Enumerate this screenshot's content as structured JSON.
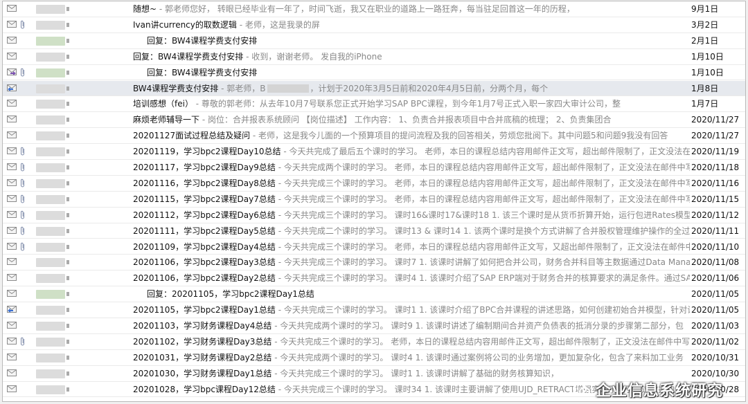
{
  "colors": {
    "subject": "#111111",
    "preview": "#888888",
    "selected_bg": "#e6e9ee",
    "row_border": "#eaeaea"
  },
  "watermark": {
    "text": "企业信息系统研究"
  },
  "emails": [
    {
      "id": "r0",
      "icon": "envelope-icon",
      "clip": false,
      "sender_color": "gray",
      "indent": false,
      "subject": "随想~",
      "preview": " - 郭老师您好， 转眼已经毕业有一年了，时间飞逝，我又在职业的道路上一路狂奔，每当驻足回首这一年的历程，",
      "date": "9月1日"
    },
    {
      "id": "r1",
      "icon": "envelope-icon",
      "clip": true,
      "sender_color": "gray",
      "indent": false,
      "subject": "Ivan讲currency的取数逻辑",
      "preview": " - 老师，这是我录的屏",
      "date": "3月2日"
    },
    {
      "id": "r2",
      "icon": "envelope-icon",
      "clip": false,
      "sender_color": "green",
      "indent": true,
      "subject": "回复：BW4课程学费支付安排",
      "preview": "",
      "date": "2月1日"
    },
    {
      "id": "r3",
      "icon": "envelope-icon",
      "clip": false,
      "sender_color": "gray",
      "indent": false,
      "subject": "回复：BW4课程学费支付安排",
      "preview": " - 收到，谢谢老师。 发自我的iPhone",
      "date": "1月10日"
    },
    {
      "id": "r4",
      "icon": "forwarded-envelope-icon",
      "clip": true,
      "sender_color": "green",
      "indent": true,
      "subject": "回复：BW4课程学费支付安排",
      "preview": "",
      "date": "1月10日"
    },
    {
      "id": "r5",
      "icon": "replied-envelope-icon",
      "clip": false,
      "sender_color": "gray",
      "indent": false,
      "subject": "BW4课程学费支付安排",
      "preview": " - 郭老师，B",
      "preview2": "，计划于2020年3月5日前和2020年4月5日前，分两个月，每个",
      "date": "1月8日",
      "selected": true
    },
    {
      "id": "r6",
      "icon": "envelope-icon",
      "clip": false,
      "sender_color": "gray",
      "indent": false,
      "subject": "培训感想（fei）",
      "preview": " - 尊敬的郭老师：从去年10月7号联系您正式开始学习SAP BPC课程，到今年1月7号正式入职一家四大审计公司，整",
      "date": "1月7日"
    },
    {
      "id": "r7",
      "icon": "envelope-icon",
      "clip": false,
      "sender_color": "gray",
      "indent": false,
      "subject": "麻烦老师辅导一下",
      "preview": " - 岗位：合并报表系统顾问 【岗位描述】 工作内容： 1、负责合并报表项目中合并底稿的梳理； 2、负责集团合",
      "date": "2020/11/27"
    },
    {
      "id": "r8",
      "icon": "envelope-icon",
      "clip": false,
      "sender_color": "gray",
      "indent": false,
      "subject": "20201127面试过程总结及疑问",
      "preview": " - 老师，这是我今儿面的一个预算项目的提问流程及我的回答相关，劳烦您批阅下。其中问题5和问题9我没有回答",
      "date": "2020/11/27"
    },
    {
      "id": "r9",
      "icon": "envelope-icon",
      "clip": true,
      "sender_color": "gray",
      "indent": false,
      "subject": "20201119，学习bpc2课程Day10总结",
      "preview": " - 今天共完成了最后五个课时的学习。 老师，本日的课程总结内容用邮件正文写，超出邮件限制了，正文没法在邮件",
      "date": "2020/11/19"
    },
    {
      "id": "r10",
      "icon": "envelope-icon",
      "clip": true,
      "sender_color": "gray",
      "indent": false,
      "subject": "20201117，学习bpc2课程Day9总结",
      "preview": " - 今天共完成两个课时的学习。 老师，本日的课程总结内容用邮件正文写，超出邮件限制了，正文没法在邮件中写",
      "date": "2020/11/18"
    },
    {
      "id": "r11",
      "icon": "envelope-icon",
      "clip": true,
      "sender_color": "gray",
      "indent": false,
      "subject": "20201116，学习bpc2课程Day8总结",
      "preview": " - 今天共完成三个课时的学习。 老师，本日的课程总结内容用邮件正文写，超出邮件限制了，正文没法在邮件中写",
      "date": "2020/11/16"
    },
    {
      "id": "r12",
      "icon": "envelope-icon",
      "clip": true,
      "sender_color": "gray",
      "indent": false,
      "subject": "20201115，学习bpc2课程Day7总结",
      "preview": " - 今天共完成三个课时的学习。 老师，本日的课程总结内容用邮件正文写，超出邮件限制了，正文没法在邮件中写",
      "date": "2020/11/15"
    },
    {
      "id": "r13",
      "icon": "envelope-icon",
      "clip": true,
      "sender_color": "gray",
      "indent": false,
      "subject": "20201112，学习bpc2课程Day6总结",
      "preview": " - 今天共完成三个课时的学习。 课时16&课时17&课时18 1. 该三个课时是从货币折算开始，运行包进Rates模型发",
      "date": "2020/11/12"
    },
    {
      "id": "r14",
      "icon": "envelope-icon",
      "clip": true,
      "sender_color": "gray",
      "indent": false,
      "subject": "20201111，学习bpc2课程Day5总结",
      "preview": " - 今天共完成二个课时的学习。 课时13 & 课时14 1. 该两个课时是换个方式讲解了合并股权管理维护操作的全过",
      "date": "2020/11/11"
    },
    {
      "id": "r15",
      "icon": "envelope-icon",
      "clip": true,
      "sender_color": "gray",
      "indent": false,
      "subject": "20201109，学习bpc2课程Day4总结",
      "preview": " - 今天共完成三个课时的学习。 老师，本日的课程总结内容用邮件正文写，又超出邮件限制了，正文没法在邮件中",
      "date": "2020/11/10"
    },
    {
      "id": "r16",
      "icon": "envelope-icon",
      "clip": false,
      "sender_color": "gray",
      "indent": false,
      "subject": "20201106，学习bpc2课程Day3总结",
      "preview": " - 今天共完成三个课时的学习。 课时7 1. 该课时讲解了如何把合并公司，财务合并科目等主数据通过Data Manage",
      "date": "2020/11/08"
    },
    {
      "id": "r17",
      "icon": "envelope-icon",
      "clip": false,
      "sender_color": "gray",
      "indent": false,
      "subject": "20201106，学习bpc2课程Day2总结",
      "preview": " - 今天共完成三个课时的学习。 课时4 1. 该课时介绍了SAP ERP端对于财务合并的核算要求的满足条件。通过SAP",
      "date": "2020/11/06"
    },
    {
      "id": "r18",
      "icon": "envelope-icon",
      "clip": false,
      "sender_color": "green",
      "indent": true,
      "subject": "回复：20201105，学习bpc2课程Day1总结",
      "preview": "",
      "date": "2020/11/05"
    },
    {
      "id": "r19",
      "icon": "replied-envelope-icon",
      "clip": false,
      "sender_color": "gray",
      "indent": false,
      "subject": "20201105，学习bpc2课程Day1总结",
      "preview": " - 今天共完成三个课时的学习。 课时1 1. 该课时介绍了BPC合并课程的讲述思路，如何创建初始合并模型，针对设",
      "date": "2020/11/05"
    },
    {
      "id": "r20",
      "icon": "envelope-icon",
      "clip": false,
      "sender_color": "gray",
      "indent": false,
      "subject": "20201103，学习财务课程Day4总结",
      "preview": " - 今天共完成两个课时的学习。 课时9 1. 该课时讲述了编制期间合并资产负债表的抵消分录的步骤第二部分，包",
      "date": "2020/11/03"
    },
    {
      "id": "r21",
      "icon": "envelope-icon",
      "clip": true,
      "sender_color": "gray",
      "indent": false,
      "subject": "20201102，学习财务课程Day3总结",
      "preview": " - 今天共完成三个课时的学习。 老师，本日的课程总结内容用邮件正文写，超出邮件限制了，正文没法在邮件中写",
      "date": "2020/11/02"
    },
    {
      "id": "r22",
      "icon": "envelope-icon",
      "clip": false,
      "sender_color": "gray",
      "indent": false,
      "subject": "20201031，学习财务课程Day2总结",
      "preview": " - 今天共完成两个课时的学习。 课时4 1. 该课时通过案例将公司的业务增加，更加复杂化，包含了来料加工业务",
      "date": "2020/10/31"
    },
    {
      "id": "r23",
      "icon": "envelope-icon",
      "clip": false,
      "sender_color": "gray",
      "indent": false,
      "subject": "20201030，学习财务课程Day1总结",
      "preview": " - 今天共完成三个课时的学习。 课时1 1. 该课时讲解了基础的财务核算知识，",
      "date": "2020/10/30"
    },
    {
      "id": "r24",
      "icon": "envelope-icon",
      "clip": false,
      "sender_color": "gray",
      "indent": false,
      "subject": "20201028，学习bpc课程Day12总结",
      "preview": " - 今天共完成三个课时的学习。 课时34 1. 该课时主要讲解了使用UJD_RETRACT增强实现了用于通过数据包设置条件，",
      "date": "2020/10/28"
    }
  ]
}
